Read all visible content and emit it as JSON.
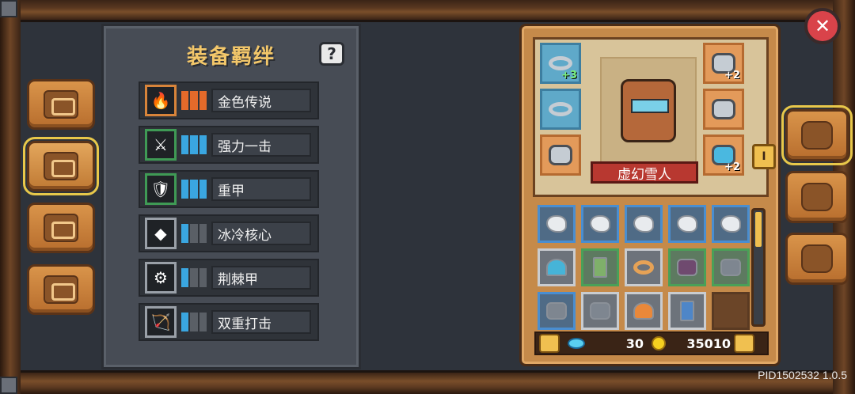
{
  "panel": {
    "title": "装备羁绊",
    "help_label": "?"
  },
  "bonds": [
    {
      "label": "金色传说",
      "icon": "flame-icon",
      "glyph": "🔥",
      "rarity": "orange"
    },
    {
      "label": "强力一击",
      "icon": "sword-icon",
      "glyph": "⚔",
      "rarity": "green"
    },
    {
      "label": "重甲",
      "icon": "armor-icon",
      "glyph": "🛡",
      "rarity": "green"
    },
    {
      "label": "冰冷核心",
      "icon": "ice-core-icon",
      "glyph": "◆",
      "rarity": "gray"
    },
    {
      "label": "荆棘甲",
      "icon": "thorn-gear-icon",
      "glyph": "⚙",
      "rarity": "gray"
    },
    {
      "label": "双重打击",
      "icon": "bow-icon",
      "glyph": "🏹",
      "rarity": "gray"
    }
  ],
  "character": {
    "name": "虚幻雪人"
  },
  "equipment": {
    "necklace_plus": "+3",
    "helmet_plus": "+2",
    "weapon_plus": "+2"
  },
  "currency": {
    "gems": "30",
    "gold": "35010"
  },
  "toggle_tab_label": "I",
  "close_label": "✕",
  "version": "PID1502532 1.0.5",
  "colors": {
    "accent_gold": "#f3c76a",
    "banner_red": "#b83830",
    "wood": "#c58a4a"
  }
}
